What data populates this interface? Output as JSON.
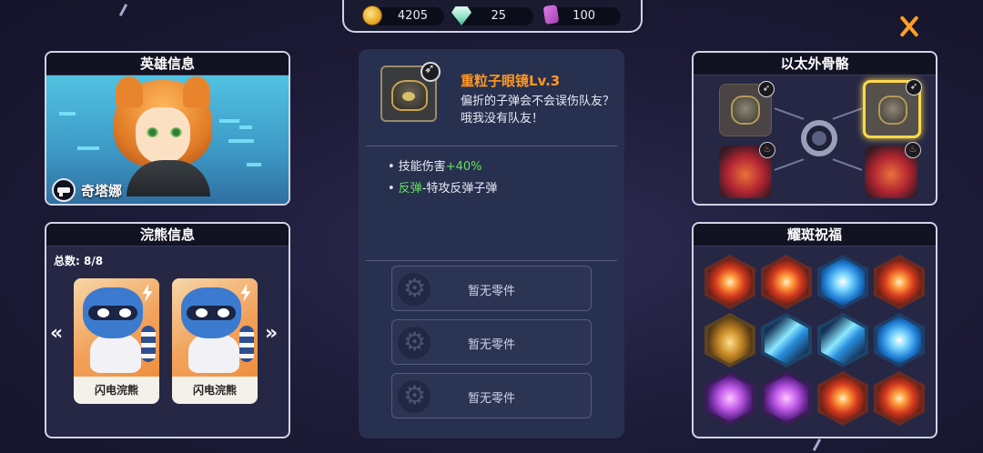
{
  "currency": {
    "coins": "4205",
    "gems": "25",
    "cards": "100"
  },
  "hero_panel": {
    "title": "英雄信息",
    "hero_name": "奇塔娜"
  },
  "raccoon_panel": {
    "title": "浣熊信息",
    "total": "总数: 8/8",
    "cards": [
      {
        "name": "闪电浣熊"
      },
      {
        "name": "闪电浣熊"
      }
    ],
    "prev_arrow": "«",
    "next_arrow": "»"
  },
  "detail_panel": {
    "item_title": "重粒子眼镜Lv.3",
    "item_desc": "偏折的子弹会不会误伤队友？哦我没有队友！",
    "stats": [
      {
        "bullet": "•",
        "prefix": "技能伤害",
        "highlight": "+40%",
        "suffix": ""
      },
      {
        "bullet": "•",
        "prefix": "",
        "highlight": "反弹",
        "suffix": "-特攻反弹子弹"
      }
    ],
    "slots": [
      {
        "label": "暂无零件"
      },
      {
        "label": "暂无零件"
      },
      {
        "label": "暂无零件"
      }
    ]
  },
  "exo_panel": {
    "title": "以太外骨骼"
  },
  "blessing_panel": {
    "title": "耀斑祝福",
    "items": [
      {
        "name": "blessing-1",
        "style": "red"
      },
      {
        "name": "blessing-2",
        "style": "red"
      },
      {
        "name": "blessing-3",
        "style": "blue"
      },
      {
        "name": "blessing-4",
        "style": "red"
      },
      {
        "name": "blessing-5",
        "style": "gold"
      },
      {
        "name": "blessing-6",
        "style": "cyan"
      },
      {
        "name": "blessing-7",
        "style": "cyan"
      },
      {
        "name": "blessing-8",
        "style": "blue"
      },
      {
        "name": "blessing-9",
        "style": "purple"
      },
      {
        "name": "blessing-10",
        "style": "purple"
      },
      {
        "name": "blessing-11",
        "style": "red"
      },
      {
        "name": "blessing-12",
        "style": "red"
      }
    ]
  },
  "colors": {
    "accent_orange": "#ff9824",
    "highlight_green": "#61e35b",
    "selected_gold": "#ffd84a"
  }
}
